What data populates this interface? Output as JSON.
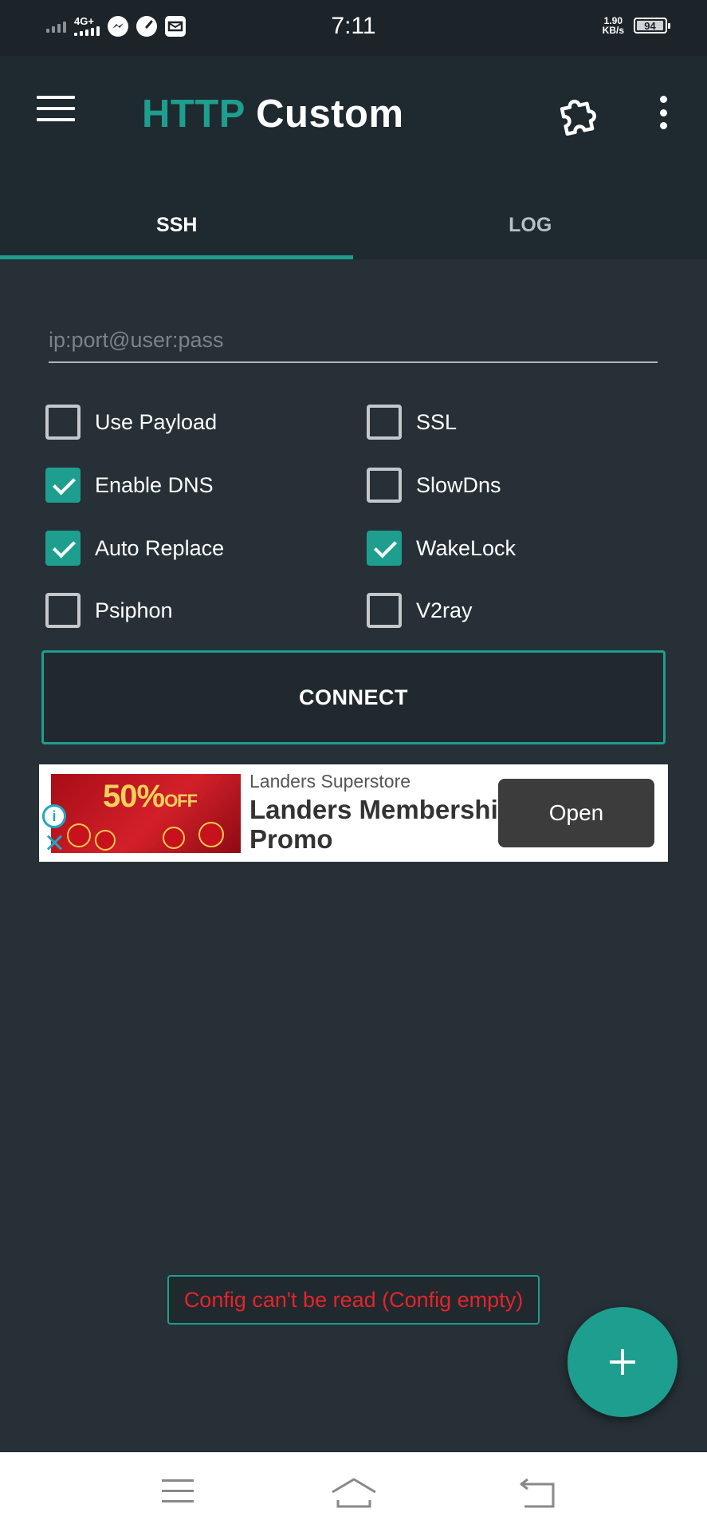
{
  "status_bar": {
    "time": "7:11",
    "network": "4G+",
    "speed_value": "1.90",
    "speed_unit": "KB/s",
    "battery": "94"
  },
  "app_bar": {
    "title_accent": "HTTP",
    "title_rest": "Custom"
  },
  "tabs": [
    {
      "label": "SSH",
      "active": true
    },
    {
      "label": "LOG",
      "active": false
    }
  ],
  "server": {
    "placeholder": "ip:port@user:pass",
    "value": ""
  },
  "options": [
    {
      "label": "Use Payload",
      "checked": false
    },
    {
      "label": "SSL",
      "checked": false
    },
    {
      "label": "Enable DNS",
      "checked": true
    },
    {
      "label": "SlowDns",
      "checked": false
    },
    {
      "label": "Auto Replace",
      "checked": true
    },
    {
      "label": "WakeLock",
      "checked": true
    },
    {
      "label": "Psiphon",
      "checked": false
    },
    {
      "label": "V2ray",
      "checked": false
    }
  ],
  "connect_label": "CONNECT",
  "ad": {
    "image_text": "50%",
    "image_text_small": "OFF",
    "advertiser": "Landers Superstore",
    "headline": "Landers Membership Promo",
    "cta": "Open"
  },
  "toast": "Config can't be read (Config empty)",
  "colors": {
    "accent": "#1e9e8f",
    "background": "#263036",
    "app_bar": "#1f2a30",
    "error": "#e5242b"
  },
  "icons": {
    "menu": "hamburger-icon",
    "plugin": "puzzle-icon",
    "more": "kebab-icon",
    "fab": "plus-icon"
  }
}
